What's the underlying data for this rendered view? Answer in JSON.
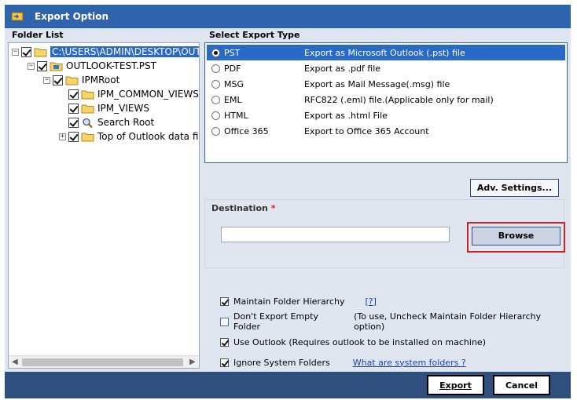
{
  "window": {
    "title": "Export Option"
  },
  "folder_list": {
    "label": "Folder List",
    "tree": [
      {
        "label": "C:\\USERS\\ADMIN\\DESKTOP\\OUTLOOK-TEST.PST",
        "checked": true,
        "selected": true,
        "expander": "-"
      },
      {
        "label": "OUTLOOK-TEST.PST",
        "checked": true,
        "expander": "-"
      },
      {
        "label": "IPMRoot",
        "checked": true,
        "expander": "-"
      },
      {
        "label": "IPM_COMMON_VIEWS",
        "checked": true
      },
      {
        "label": "IPM_VIEWS",
        "checked": true
      },
      {
        "label": "Search Root",
        "checked": true,
        "icon": "search-icon"
      },
      {
        "label": "Top of Outlook data file",
        "checked": true,
        "expander": "+"
      }
    ]
  },
  "export_type": {
    "label": "Select Export Type",
    "options": [
      {
        "name": "PST",
        "desc": "Export as Microsoft Outlook (.pst) file",
        "selected": true
      },
      {
        "name": "PDF",
        "desc": "Export as .pdf file"
      },
      {
        "name": "MSG",
        "desc": "Export as Mail Message(.msg) file"
      },
      {
        "name": "EML",
        "desc": "RFC822 (.eml) file.(Applicable only for mail)"
      },
      {
        "name": "HTML",
        "desc": "Export as .html File"
      },
      {
        "name": "Office 365",
        "desc": "Export to Office 365 Account"
      }
    ]
  },
  "buttons": {
    "adv_settings": "Adv. Settings...",
    "browse": "Browse",
    "export": "Export",
    "cancel": "Cancel"
  },
  "destination": {
    "label": "Destination",
    "required_mark": "*",
    "value": ""
  },
  "options": {
    "maintain_hierarchy": {
      "label": "Maintain Folder Hierarchy",
      "help": "[?]",
      "checked": true
    },
    "no_empty_folder": {
      "label": "Don't Export Empty Folder",
      "note": "(To use, Uncheck Maintain Folder Hierarchy option)",
      "checked": false
    },
    "use_outlook": {
      "label": "Use Outlook (Requires outlook to be installed on machine)",
      "checked": true
    },
    "ignore_system": {
      "label": "Ignore System Folders",
      "link": "What are system folders ?",
      "checked": true
    }
  },
  "colors": {
    "title_bar": "#2f63ab",
    "footer_bar": "#2f4f7f",
    "selection": "#2a6ac7",
    "highlight_border": "#d42020",
    "panel_bg": "#dfe6ef"
  }
}
